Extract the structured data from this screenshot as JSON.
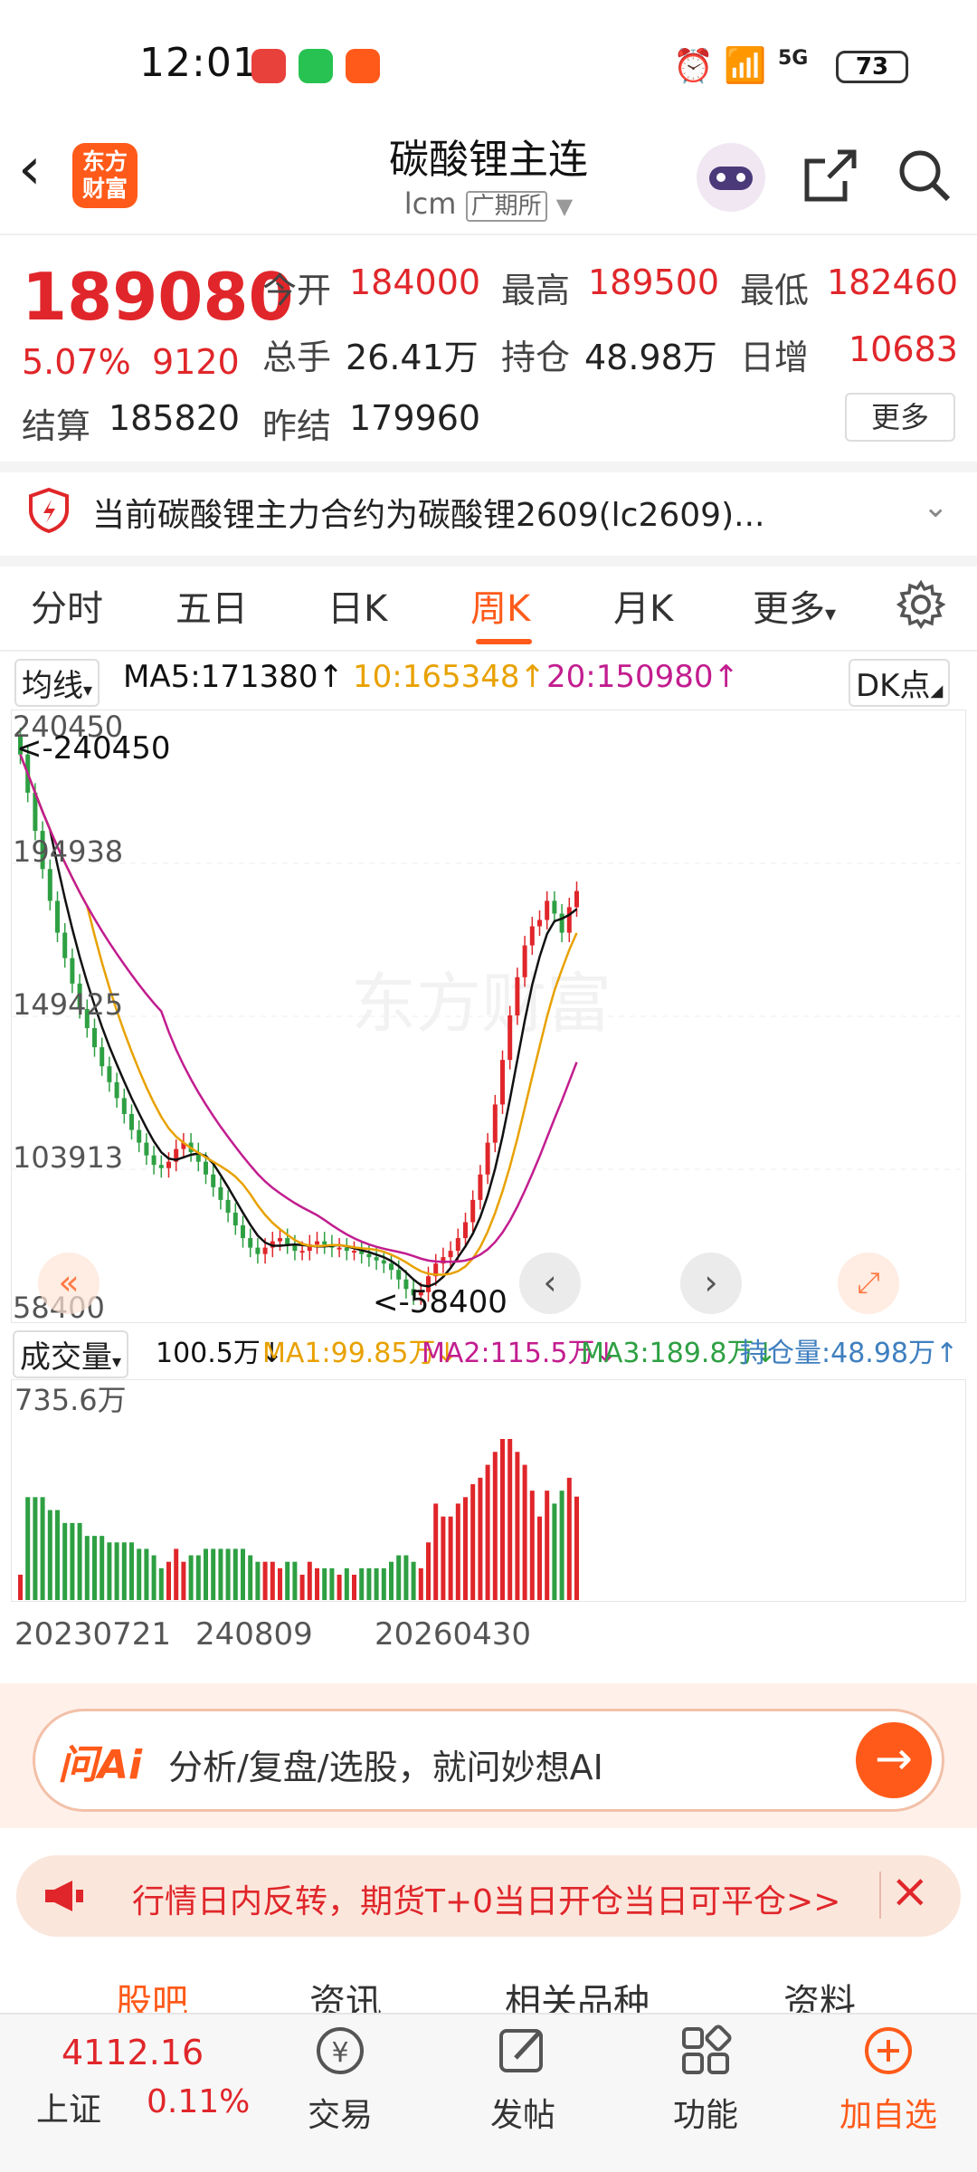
{
  "status_bar": {
    "time": "12:01",
    "battery": "73",
    "network": "5G"
  },
  "nav": {
    "logo_line1": "东方",
    "logo_line2": "财富",
    "title": "碳酸锂主连",
    "code": "lcm",
    "exchange": "广期所"
  },
  "quote": {
    "price": "189080",
    "change_pct": "5.07%",
    "change": "9120",
    "open_label": "今开",
    "open": "184000",
    "high_label": "最高",
    "high": "189500",
    "low_label": "最低",
    "low": "182460",
    "volume_label": "总手",
    "volume": "26.41万",
    "oi_label": "持仓",
    "oi": "48.98万",
    "daily_inc_label": "日增",
    "daily_inc": "10683",
    "settle_label": "结算",
    "settle": "185820",
    "prev_settle_label": "昨结",
    "prev_settle": "179960",
    "more": "更多"
  },
  "notice": {
    "text": "当前碳酸锂主力合约为碳酸锂2609(lc2609)..."
  },
  "tabs": [
    "分时",
    "五日",
    "日K",
    "周K",
    "月K",
    "更多"
  ],
  "active_tab": "周K",
  "ma": {
    "selector": "均线",
    "ma5": "MA5:171380↑",
    "ma10": "10:165348↑",
    "ma20": "20:150980↑",
    "dk": "DK点"
  },
  "volume_indicator": {
    "selector": "成交量",
    "vol": "100.5万↓",
    "ma1": "MA1:99.85万↓",
    "ma2": "MA2:115.5万↓",
    "ma3": "MA3:189.8万↓",
    "oi": "持仓量:48.98万↑",
    "max_label": "735.6万"
  },
  "colors": {
    "up": "#e0262a",
    "down": "#2ea043",
    "accent": "#ff5a1a",
    "ma5": "#111111",
    "ma10": "#e8a100",
    "ma20": "#c21d8f",
    "oi_line": "#3f7fbf"
  },
  "chart_data": {
    "type": "candlestick",
    "y_ticks": [
      "240450",
      "194938",
      "149425",
      "103913",
      "58400"
    ],
    "ylim": [
      58400,
      240450
    ],
    "x_tick_labels": [
      "20230721",
      "240809",
      "20260430"
    ],
    "annotations": [
      "<-240450",
      "<-58400"
    ],
    "watermark": "东方财富",
    "close": [
      232000,
      220000,
      208000,
      196000,
      186000,
      176000,
      168000,
      160000,
      152000,
      146000,
      140000,
      134000,
      129000,
      124000,
      119000,
      114000,
      110000,
      106000,
      103000,
      102000,
      104000,
      108000,
      110000,
      107000,
      104000,
      100000,
      96000,
      92000,
      88000,
      84000,
      80000,
      77000,
      75000,
      77000,
      79000,
      80000,
      78000,
      76000,
      76000,
      78000,
      79000,
      78000,
      77000,
      77000,
      76000,
      76000,
      75000,
      74000,
      73000,
      72000,
      70000,
      67000,
      64000,
      62000,
      63000,
      68000,
      72000,
      74000,
      76000,
      80000,
      85000,
      92000,
      100000,
      110000,
      122000,
      136000,
      150000,
      162000,
      172000,
      178000,
      180000,
      186000,
      182000,
      176000,
      184000,
      189080
    ],
    "ma5": [
      171380
    ],
    "ma10": [
      165348
    ],
    "ma20": [
      150980
    ],
    "volume_max": "735.6万"
  },
  "ai": {
    "logo": "问Ai",
    "placeholder": "分析/复盘/选股，就问妙想AI"
  },
  "promo": {
    "text": "行情日内反转，期货T+0当日开仓当日可平仓>>"
  },
  "sub_tabs": [
    "股吧",
    "资讯",
    "相关品种",
    "资料"
  ],
  "bottom_nav": {
    "index_value": "4112.16",
    "index_name": "上证",
    "index_change": "0.11%",
    "items": [
      "交易",
      "发帖",
      "功能",
      "加自选"
    ]
  }
}
